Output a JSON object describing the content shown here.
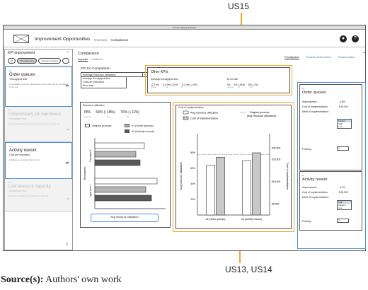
{
  "callouts": {
    "top": "US15",
    "bottom": "US13, US14"
  },
  "window": {
    "title": "Process Mining Software"
  },
  "nav": {
    "app_title": "Improvement Opportunities",
    "tabs": [
      "Overview",
      "Comparison"
    ],
    "profile_icon": "user-circle-icon",
    "help_icon": "question-circle-icon"
  },
  "sidebar": {
    "title": "KPI improvement",
    "chips": [
      "All",
      "Throughput time",
      "Cost per execution",
      "..."
    ],
    "items": [
      {
        "num": "#1",
        "title": "Order queues",
        "sub": "Throughput time",
        "desc": "An available resource to accelerate review; order will be forwarded to the next",
        "state": "selected"
      },
      {
        "num": "#2",
        "title": "Unnecessary job handovers",
        "sub": "Throughput time",
        "desc": "Unnecessary hand-overs of the processing to the next role",
        "state": "disabled"
      },
      {
        "num": "#3",
        "title": "Activity rework",
        "sub": "Cost per execution",
        "desc": "Activities are repeated due to errors",
        "state": "selected"
      },
      {
        "num": "#4",
        "title": "Low resource capacity",
        "sub": "Throughput time",
        "desc": "Resource utilization is insufficient for the work",
        "state": "disabled"
      }
    ],
    "back_icon": "chevron-left-icon"
  },
  "main": {
    "title": "Comparison",
    "subtabs": [
      "Separate",
      "Combined"
    ],
    "toptabs": [
      "Prioritization",
      "Process performance",
      "Process maps"
    ],
    "kpi_comparison": {
      "heading": "KPI for Comparison",
      "selected": "Average resource utilization",
      "options": [
        "Average throughput time",
        "Cost per execution",
        "Error rate"
      ]
    },
    "other_kpis": {
      "heading": "Other KPIs",
      "groups": [
        {
          "label": "Average throughput time",
          "values": [
            "12.7 hrs",
            "11.6 hrs (↓11%)",
            "11.0 hrs (↓13%)"
          ],
          "subs": [
            "original",
            "#1",
            "#3"
          ]
        },
        {
          "label": "Error rate",
          "values": [
            "9%",
            "6% (↓35%)",
            "8% (↓1%)"
          ],
          "subs": [
            "original",
            "#1",
            "#3"
          ]
        }
      ]
    },
    "resource": {
      "title": "Resource utilization",
      "values": [
        "78%",
        "64% (↑18%)",
        "70% (↓11%)"
      ],
      "subs": [
        "original",
        "#1",
        "#3"
      ],
      "legend": {
        "original": "Original process",
        "order": "#1 (Order queues)",
        "rework": "#3 (Activity rework)"
      },
      "bottom_label": "Avg resource utilization"
    },
    "cost": {
      "title": "Cost of implementation",
      "legend": {
        "avg": "Avg resource utilization",
        "cost": "Cost of implementation",
        "original": "Original process\n(avg resource utilization)"
      }
    },
    "right_panel": {
      "cards": [
        {
          "num": "#1",
          "title": "Order queues",
          "improvement_label": "Improvement:",
          "improvement": "↓18%",
          "cost_label": "Cost of implementation:",
          "cost": "€26,000",
          "effort_label": "Effort of implementation:",
          "effort_options": [
            "Medium",
            "High",
            "Low"
          ],
          "effort_selected": "Medium",
          "priority_label": "Priority:",
          "priority": "1"
        },
        {
          "num": "#3",
          "title": "Activity rework",
          "improvement_label": "Improvement:",
          "improvement": "↓11%",
          "cost_label": "Cost of implementation:",
          "cost": "€28,000",
          "effort_label": "Effort of implementation:",
          "effort_options": [
            "High",
            "Medium",
            "Low"
          ],
          "effort_selected": "High",
          "priority_label": "Priority:",
          "priority": "2"
        }
      ]
    }
  },
  "chart_data": [
    {
      "type": "bar",
      "title": "Resource utilization",
      "orientation": "horizontal",
      "ylabel": "Resources",
      "xlabel": "Avg resource utilization",
      "categories": [
        "Developer 1",
        "Legal clerk 1"
      ],
      "series": [
        {
          "name": "Original process",
          "values": [
            70,
            88
          ],
          "color": "#ffffff"
        },
        {
          "name": "#1 (Order queues)",
          "values": [
            58,
            72
          ],
          "color": "#b5b5b5"
        },
        {
          "name": "#3 (Activity rework)",
          "values": [
            64,
            80
          ],
          "color": "#5a5a5a"
        }
      ],
      "xlim": [
        0,
        100
      ]
    },
    {
      "type": "bar",
      "title": "Cost of implementation",
      "categories": [
        "#1 (Order queues)",
        "#3 (Activity rework)"
      ],
      "ylabel": "Avg resource utilization",
      "ylabel_right": "Cost of implementation",
      "yticks": [
        "20%",
        "40%",
        "60%",
        "80%"
      ],
      "yticks_right": [
        "€5,000",
        "€15,000",
        "€25,000",
        "€30,000"
      ],
      "series": [
        {
          "name": "Avg resource utilization",
          "values": [
            64,
            70
          ],
          "color": "#ffffff"
        },
        {
          "name": "Cost of implementation",
          "values": [
            26000,
            28000
          ],
          "color": "#c8c8c8"
        }
      ],
      "reference_line": {
        "name": "Original process (avg resource utilization)",
        "value": 78
      },
      "ylim": [
        0,
        100
      ],
      "ylim_right": [
        0,
        35000
      ]
    }
  ]
}
